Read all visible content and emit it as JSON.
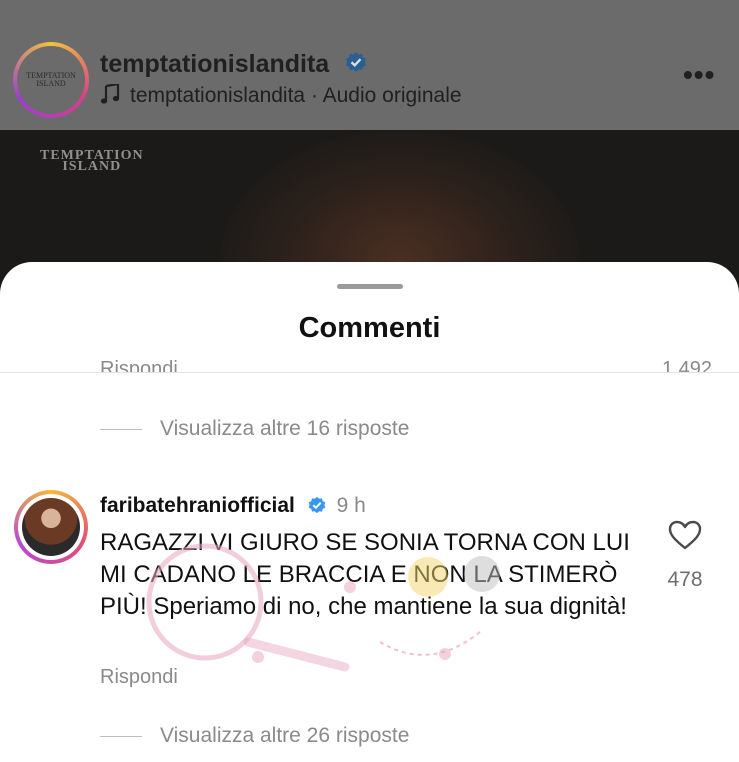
{
  "header": {
    "account_name": "temptationislandita",
    "avatar_text": "TEMPTATION ISLAND",
    "audio_line": "temptationislandita · Audio originale",
    "more_icon": "more-horizontal-icon",
    "verified_icon": "verified-badge-icon"
  },
  "video": {
    "logo_text_1": "TEMPTATION",
    "logo_text_2": "ISLAND"
  },
  "sheet": {
    "title": "Commenti",
    "cut_reply_label": "Rispondi",
    "cut_like_count": "1.492"
  },
  "thread_top": {
    "view_replies": "Visualizza altre 16 risposte"
  },
  "comment": {
    "username": "faribatehraniofficial",
    "time": "9 h",
    "text": "RAGAZZI VI GIURO SE SONIA TORNA CON LUI MI CADANO LE BRACCIA E NON LA STIMERÒ PIÙ! Speriamo di no, che mantiene la sua dignità!",
    "reply_label": "Rispondi",
    "like_count": "478",
    "view_replies": "Visualizza altre 26 risposte"
  },
  "colors": {
    "verified_blue": "#3897f0",
    "muted_text": "#8a8a8a",
    "dim_overlay": "#6b6b6b",
    "watermark_pink": "#e8a4c0"
  }
}
